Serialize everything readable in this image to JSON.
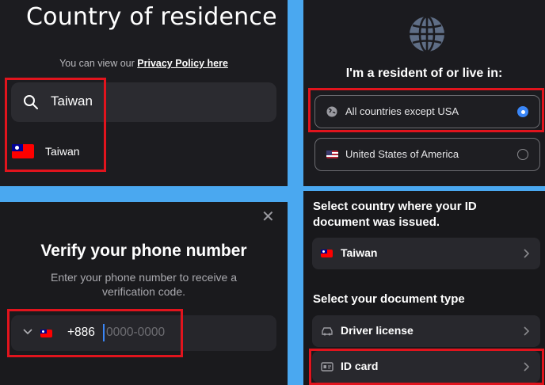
{
  "country_screen": {
    "title": "Country of residence",
    "policy_prefix": "You can view our ",
    "policy_link": "Privacy Policy here",
    "search": {
      "value": "Taiwan",
      "icon": "search-icon"
    },
    "result": {
      "name": "Taiwan",
      "flag": "taiwan-flag-icon"
    }
  },
  "residency_screen": {
    "heading": "I'm a resident of or live in:",
    "options": [
      {
        "label": "All countries except USA",
        "selected": true,
        "icon": "globe-icon"
      },
      {
        "label": "United States of America",
        "selected": false,
        "icon": "us-flag-icon"
      }
    ]
  },
  "phone_screen": {
    "title": "Verify your phone number",
    "subtitle": "Enter your phone number to receive a verification code.",
    "dial_code": "+886",
    "placeholder": "0000-0000"
  },
  "document_screen": {
    "issuer_heading": "Select country where your ID document was issued.",
    "issuer_country": "Taiwan",
    "type_heading": "Select your document type",
    "types": [
      {
        "label": "Driver license",
        "icon": "car-icon"
      },
      {
        "label": "ID card",
        "icon": "id-card-icon"
      }
    ]
  },
  "colors": {
    "highlight": "#e1141d",
    "accent": "#3a86f7",
    "divider": "#4aa8f0"
  }
}
